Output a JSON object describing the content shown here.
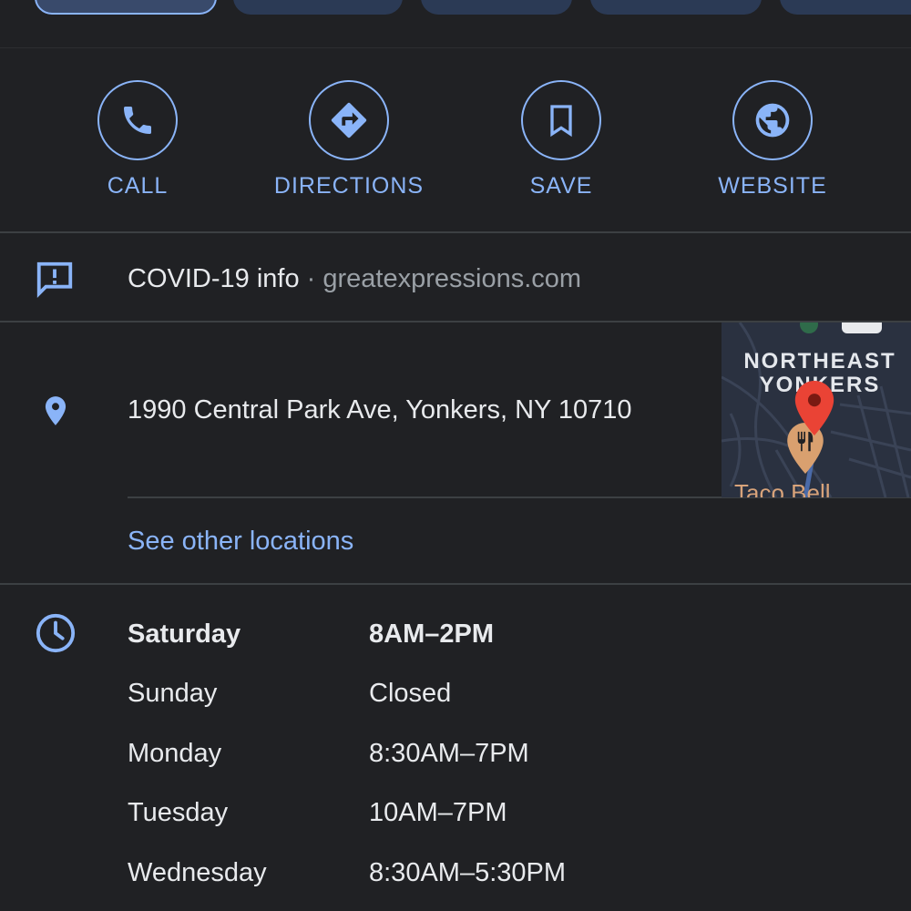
{
  "actions": [
    {
      "label": "CALL",
      "icon": "phone-icon"
    },
    {
      "label": "DIRECTIONS",
      "icon": "directions-icon"
    },
    {
      "label": "SAVE",
      "icon": "bookmark-icon"
    },
    {
      "label": "WEBSITE",
      "icon": "globe-icon"
    }
  ],
  "covid": {
    "label": "COVID-19 info",
    "separator": "·",
    "site": "greatexpressions.com",
    "icon": "alert-message-icon"
  },
  "address": {
    "text": "1990 Central Park Ave, Yonkers, NY 10710",
    "see_other": "See other locations",
    "icon": "location-pin-icon"
  },
  "map": {
    "place_line1": "NORTHEAST",
    "place_line2": "YONKERS",
    "poi": "Taco Bell"
  },
  "hours": {
    "icon": "clock-icon",
    "rows": [
      {
        "day": "Saturday",
        "time": "8AM–2PM",
        "today": true
      },
      {
        "day": "Sunday",
        "time": "Closed"
      },
      {
        "day": "Monday",
        "time": "8:30AM–7PM"
      },
      {
        "day": "Tuesday",
        "time": "10AM–7PM"
      },
      {
        "day": "Wednesday",
        "time": "8:30AM–5:30PM"
      }
    ]
  },
  "colors": {
    "background": "#202124",
    "accent": "#8ab4f8",
    "text": "#e8eaed",
    "muted": "#9aa0a6",
    "map_pin": "#ea4335"
  }
}
